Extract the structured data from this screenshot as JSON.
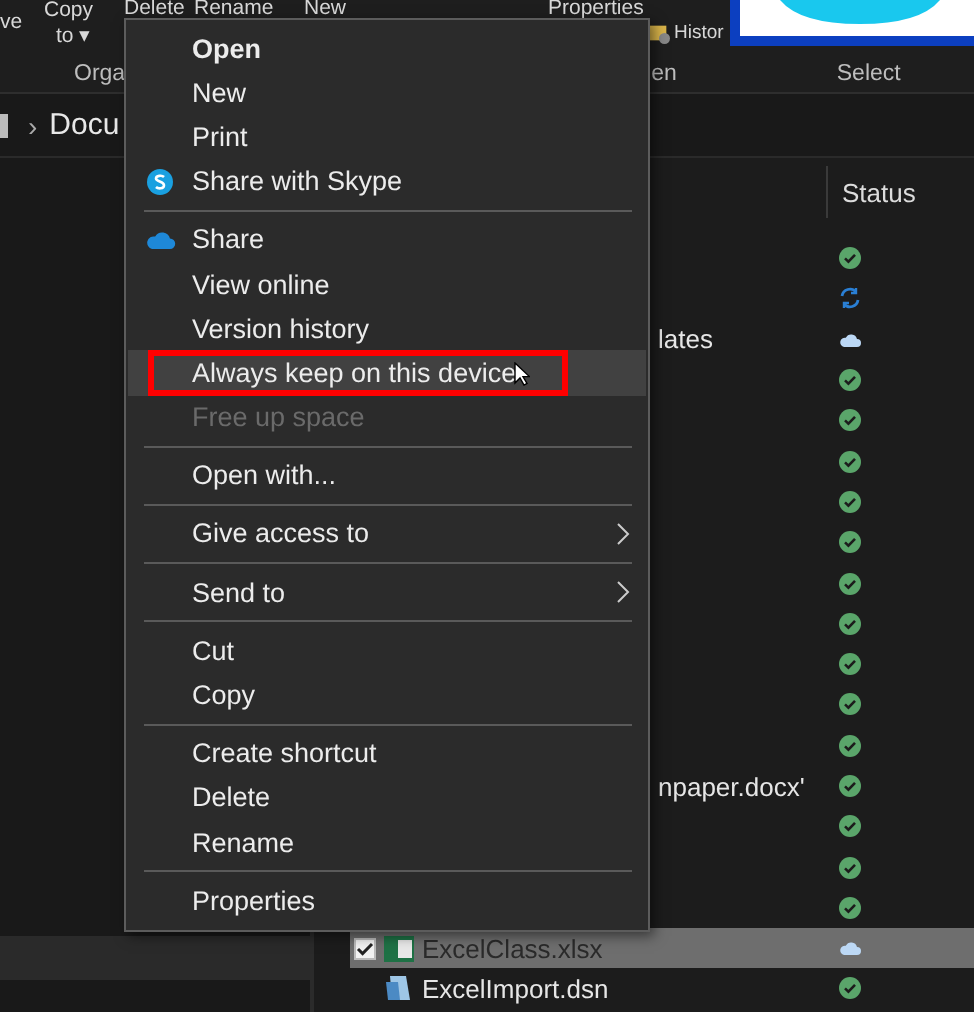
{
  "ribbon": {
    "buttons": [
      {
        "label": "ve",
        "kind": "plain"
      },
      {
        "label": "Copy",
        "sublabel": "to ▾",
        "kind": "dropdown"
      },
      {
        "label": "Delete",
        "kind": "plain"
      },
      {
        "label": "Rename",
        "kind": "plain"
      },
      {
        "label": "New",
        "kind": "plain"
      },
      {
        "label": "Properties",
        "kind": "plain"
      },
      {
        "label": "Histor",
        "kind": "history"
      }
    ],
    "groups": [
      "Orga",
      "en",
      "Select"
    ]
  },
  "breadcrumb": {
    "separator": "›",
    "path": "Docu"
  },
  "file_list": {
    "columns": [
      "Status"
    ],
    "rows": [
      {
        "name": "",
        "kind": "synced",
        "selected": false
      },
      {
        "name": "",
        "kind": "syncing",
        "selected": false
      },
      {
        "name": "lates",
        "kind": "cloud",
        "selected": false
      },
      {
        "name": "",
        "kind": "synced",
        "selected": false
      },
      {
        "name": "",
        "kind": "synced",
        "selected": false
      },
      {
        "name": "",
        "kind": "synced",
        "selected": false
      },
      {
        "name": "",
        "kind": "synced",
        "selected": false
      },
      {
        "name": "",
        "kind": "synced",
        "selected": false
      },
      {
        "name": "",
        "kind": "synced",
        "selected": false
      },
      {
        "name": "",
        "kind": "synced",
        "selected": false
      },
      {
        "name": "",
        "kind": "synced",
        "selected": false
      },
      {
        "name": "",
        "kind": "synced",
        "selected": false
      },
      {
        "name": "",
        "kind": "synced",
        "selected": false
      },
      {
        "name": "npaper.docx'",
        "kind": "synced",
        "selected": false
      },
      {
        "name": "",
        "kind": "synced",
        "selected": false
      },
      {
        "name": "",
        "kind": "synced",
        "selected": false
      },
      {
        "name": "",
        "kind": "synced",
        "selected": false
      },
      {
        "name": "ExcelClass.xlsx",
        "kind": "cloud",
        "selected": true,
        "checked": true,
        "file": {
          "kind": "excel"
        }
      },
      {
        "name": "ExcelImport.dsn",
        "kind": "synced",
        "selected": false,
        "file": {
          "kind": "dsn"
        }
      }
    ]
  },
  "context_menu": {
    "items": [
      {
        "kind": "item",
        "label": "Open",
        "default": true,
        "disabled": false,
        "hovered": false,
        "submenu": false
      },
      {
        "kind": "item",
        "label": "New",
        "default": false,
        "disabled": false,
        "hovered": false,
        "submenu": false
      },
      {
        "kind": "item",
        "label": "Print",
        "default": false,
        "disabled": false,
        "hovered": false,
        "submenu": false
      },
      {
        "kind": "skype",
        "label": "Share with Skype",
        "default": false,
        "disabled": false,
        "hovered": false,
        "submenu": false
      },
      {
        "kind": "separator"
      },
      {
        "kind": "cloud",
        "label": "Share",
        "default": false,
        "disabled": false,
        "hovered": false,
        "submenu": false
      },
      {
        "kind": "item",
        "label": "View online",
        "default": false,
        "disabled": false,
        "hovered": false,
        "submenu": false
      },
      {
        "kind": "item",
        "label": "Version history",
        "default": false,
        "disabled": false,
        "hovered": false,
        "submenu": false
      },
      {
        "kind": "item",
        "label": "Always keep on this device",
        "default": false,
        "disabled": false,
        "hovered": true,
        "highlighted": true,
        "submenu": false
      },
      {
        "kind": "item",
        "label": "Free up space",
        "default": false,
        "disabled": true,
        "hovered": false,
        "submenu": false
      },
      {
        "kind": "separator"
      },
      {
        "kind": "item",
        "label": "Open with...",
        "default": false,
        "disabled": false,
        "hovered": false,
        "submenu": false
      },
      {
        "kind": "separator"
      },
      {
        "kind": "item",
        "label": "Give access to",
        "default": false,
        "disabled": false,
        "hovered": false,
        "submenu": true
      },
      {
        "kind": "separator"
      },
      {
        "kind": "item",
        "label": "Send to",
        "default": false,
        "disabled": false,
        "hovered": false,
        "submenu": true
      },
      {
        "kind": "separator"
      },
      {
        "kind": "item",
        "label": "Cut",
        "default": false,
        "disabled": false,
        "hovered": false,
        "submenu": false
      },
      {
        "kind": "item",
        "label": "Copy",
        "default": false,
        "disabled": false,
        "hovered": false,
        "submenu": false
      },
      {
        "kind": "separator"
      },
      {
        "kind": "item",
        "label": "Create shortcut",
        "default": false,
        "disabled": false,
        "hovered": false,
        "submenu": false
      },
      {
        "kind": "item",
        "label": "Delete",
        "default": false,
        "disabled": false,
        "hovered": false,
        "submenu": false
      },
      {
        "kind": "item",
        "label": "Rename",
        "default": false,
        "disabled": false,
        "hovered": false,
        "submenu": false
      },
      {
        "kind": "separator"
      },
      {
        "kind": "item",
        "label": "Properties",
        "default": false,
        "disabled": false,
        "hovered": false,
        "submenu": false
      }
    ]
  }
}
